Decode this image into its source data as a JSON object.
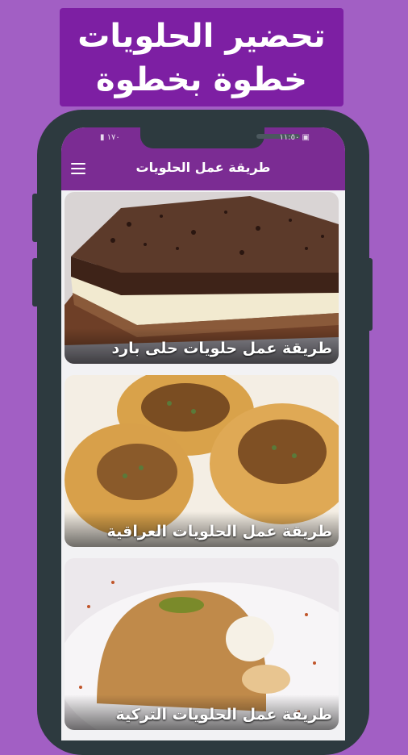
{
  "banner": {
    "line1": "تحضير الحلويات",
    "line2": "خطوة بخطوة"
  },
  "status_bar": {
    "left": "▮ ١٧٠",
    "right": "١١:٥٠ ▣"
  },
  "app_bar": {
    "title": "طريقة عمل الحلويات",
    "menu_icon": "hamburger-menu-icon"
  },
  "recipes": [
    {
      "label": "طريقة عمل حلويات حلى بارد",
      "image": "cold-dessert-chocolate-layer-cake"
    },
    {
      "label": "طريقة عمل الحلويات العراقية",
      "image": "baklava-nests-with-pistachio"
    },
    {
      "label": "طريقة عمل الحلويات التركية",
      "image": "semolina-dome-dessert"
    }
  ],
  "colors": {
    "background": "#a25fc4",
    "banner": "#7d1fa3",
    "app_bar": "#7b2c93",
    "phone_frame": "#2d3a3f"
  }
}
